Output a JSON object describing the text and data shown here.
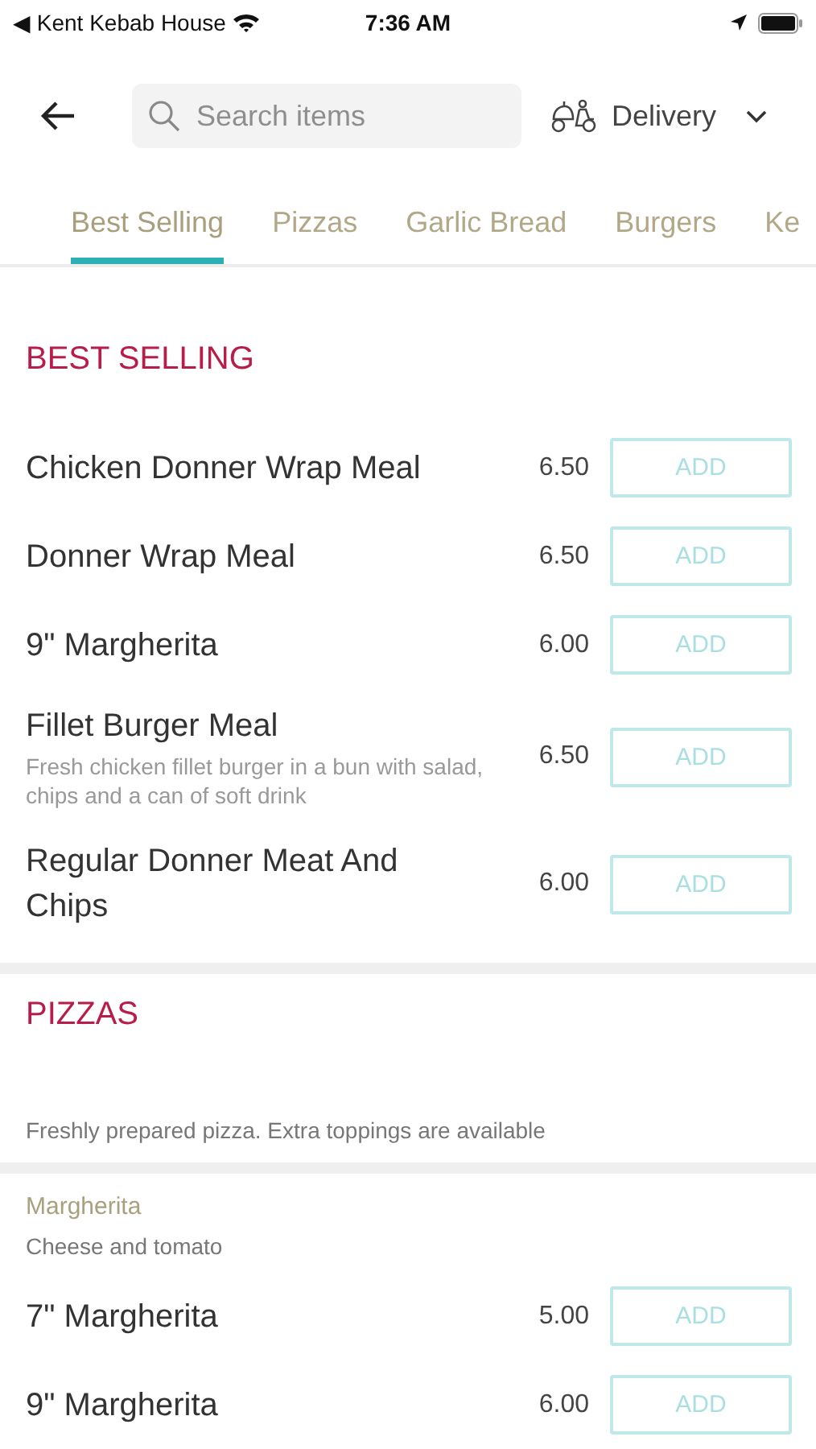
{
  "status_bar": {
    "back_app": "◀ Kent Kebab House",
    "time": "7:36 AM"
  },
  "header": {
    "search": {
      "placeholder": "Search items"
    },
    "mode": "Delivery"
  },
  "tabs": [
    {
      "label": "Best Selling",
      "selected": true
    },
    {
      "label": "Pizzas",
      "selected": false
    },
    {
      "label": "Garlic Bread",
      "selected": false
    },
    {
      "label": "Burgers",
      "selected": false
    },
    {
      "label": "Ke",
      "selected": false
    }
  ],
  "sections": [
    {
      "title": "BEST SELLING",
      "groups": [
        {
          "items": [
            {
              "name": "Chicken Donner Wrap Meal",
              "price": "6.50",
              "button": "ADD"
            },
            {
              "name": "Donner Wrap Meal",
              "price": "6.50",
              "button": "ADD"
            },
            {
              "name": "9\" Margherita",
              "price": "6.00",
              "button": "ADD"
            },
            {
              "name": "Fillet Burger Meal",
              "description": "Fresh chicken fillet burger in a bun with salad, chips and a can of soft drink",
              "price": "6.50",
              "button": "ADD"
            },
            {
              "name": "Regular Donner Meat And Chips",
              "price": "6.00",
              "button": "ADD"
            }
          ]
        }
      ]
    },
    {
      "title": "PIZZAS",
      "description": "Freshly prepared pizza. Extra toppings are available",
      "groups": [
        {
          "heading": "Margherita",
          "note": "Cheese and tomato",
          "items": [
            {
              "name": "7\" Margherita",
              "price": "5.00",
              "button": "ADD"
            },
            {
              "name": "9\" Margherita",
              "price": "6.00",
              "button": "ADD"
            }
          ]
        }
      ]
    }
  ]
}
